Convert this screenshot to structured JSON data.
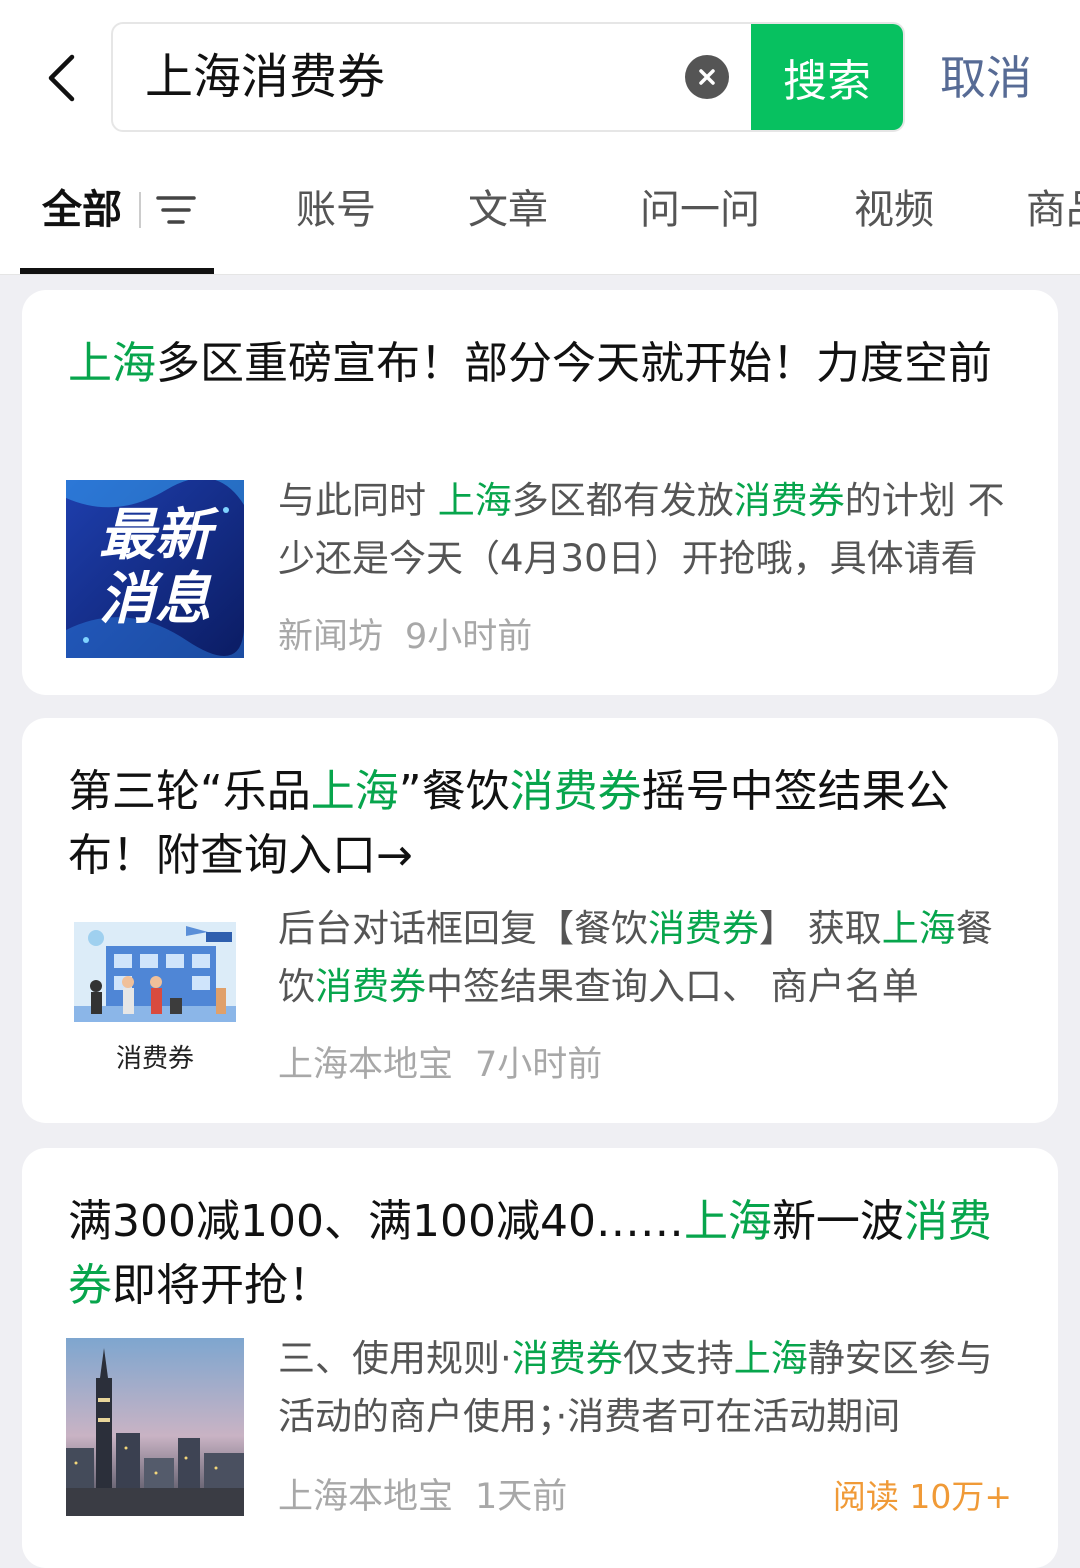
{
  "search": {
    "query": "上海消费券",
    "search_label": "搜索",
    "cancel_label": "取消"
  },
  "tabs": [
    "全部",
    "账号",
    "文章",
    "问一问",
    "视频",
    "商品"
  ],
  "results": [
    {
      "title_parts": [
        {
          "text": "上海",
          "hl": true
        },
        {
          "text": "多区重磅宣布！部分今天就开始！力度空前",
          "hl": false
        }
      ],
      "snippet_parts": [
        {
          "text": "与此同时 ",
          "hl": false
        },
        {
          "text": "上海",
          "hl": true
        },
        {
          "text": "多区都有发放",
          "hl": false
        },
        {
          "text": "消费券",
          "hl": true
        },
        {
          "text": "的计划 不少还是今天（4月30日）开抢哦，具体请看",
          "hl": false
        }
      ],
      "thumb_text": [
        "最新",
        "消息"
      ],
      "source": "新闻坊",
      "time": "9小时前"
    },
    {
      "title_parts": [
        {
          "text": "第三轮“乐品",
          "hl": false
        },
        {
          "text": "上海",
          "hl": true
        },
        {
          "text": "”餐饮",
          "hl": false
        },
        {
          "text": "消费券",
          "hl": true
        },
        {
          "text": "摇号中签结果公布！附查询入口→",
          "hl": false
        }
      ],
      "snippet_parts": [
        {
          "text": "后台对话框回复【餐饮",
          "hl": false
        },
        {
          "text": "消费券",
          "hl": true
        },
        {
          "text": "】 获取",
          "hl": false
        },
        {
          "text": "上海",
          "hl": true
        },
        {
          "text": "餐饮",
          "hl": false
        },
        {
          "text": "消费券",
          "hl": true
        },
        {
          "text": "中签结果查询入口、 商户名单",
          "hl": false
        }
      ],
      "thumb_caption": "消费券",
      "source": "上海本地宝",
      "time": "7小时前"
    },
    {
      "title_parts": [
        {
          "text": "满300减100、满100减40……",
          "hl": false
        },
        {
          "text": "上海",
          "hl": true
        },
        {
          "text": "新一波",
          "hl": false
        },
        {
          "text": "消费券",
          "hl": true
        },
        {
          "text": "即将开抢！",
          "hl": false
        }
      ],
      "snippet_parts": [
        {
          "text": "三、使用规则·",
          "hl": false
        },
        {
          "text": "消费券",
          "hl": true
        },
        {
          "text": "仅支持",
          "hl": false
        },
        {
          "text": "上海",
          "hl": true
        },
        {
          "text": "静安区参与活动的商户使用；·消费者可在活动期间",
          "hl": false
        }
      ],
      "source": "上海本地宝",
      "time": "1天前",
      "reads": "阅读 10万+"
    }
  ],
  "colors": {
    "accent_green": "#07c160",
    "highlight_green": "#07a54c",
    "cancel_blue": "#576b95",
    "reads_orange": "#f09a37"
  },
  "icons": [
    "chevron-left-icon",
    "clear-icon",
    "filter-icon"
  ]
}
